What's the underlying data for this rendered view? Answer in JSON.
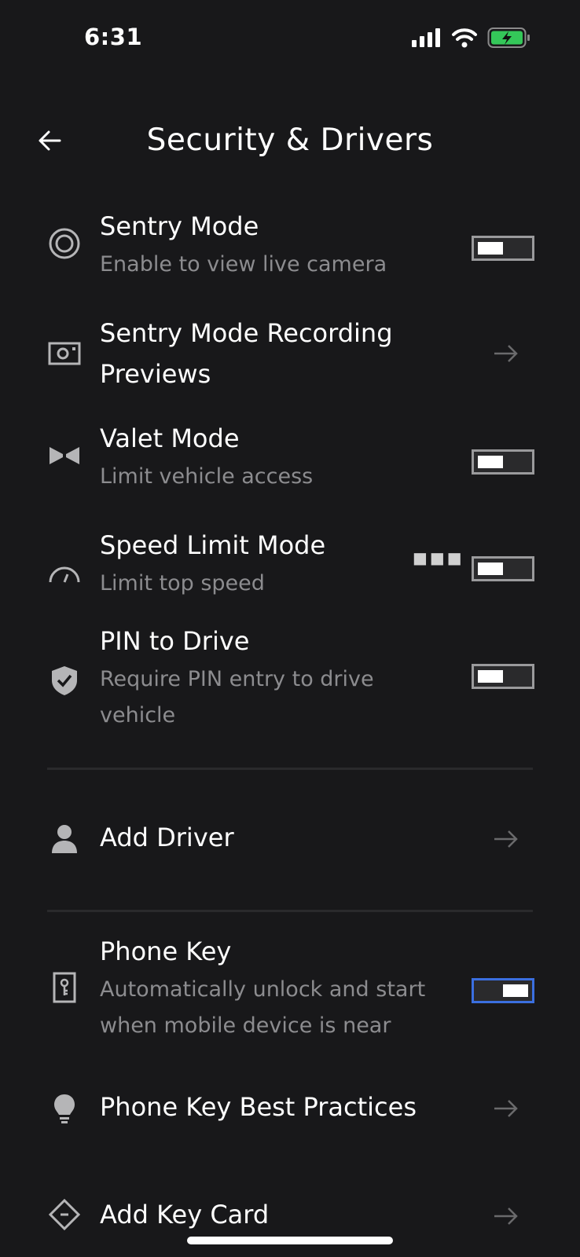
{
  "status_bar": {
    "time": "6:31"
  },
  "header": {
    "title": "Security & Drivers"
  },
  "rows": {
    "sentry": {
      "label": "Sentry Mode",
      "sub": "Enable to view live camera",
      "toggle": "off"
    },
    "sentry_previews": {
      "label1": "Sentry Mode Recording",
      "label2": "Previews"
    },
    "valet": {
      "label": "Valet Mode",
      "sub": "Limit vehicle access",
      "toggle": "off"
    },
    "speed_limit": {
      "label": "Speed Limit Mode",
      "sub": "Limit top speed",
      "toggle": "off"
    },
    "pin": {
      "label": "PIN to Drive",
      "sub1": "Require PIN entry to drive",
      "sub2": "vehicle",
      "toggle": "off"
    },
    "add_driver": {
      "label": "Add Driver"
    },
    "phone_key": {
      "label": "Phone Key",
      "sub1": "Automatically unlock and start",
      "sub2": "when mobile device is near",
      "toggle": "on"
    },
    "best_practices": {
      "label": "Phone Key Best Practices"
    },
    "key_card": {
      "label": "Add Key Card"
    }
  },
  "colors": {
    "background": "#18181a",
    "toggle_on": "#3b6fe0",
    "secondary_text": "#8c8c8f",
    "battery": "#34c759"
  }
}
